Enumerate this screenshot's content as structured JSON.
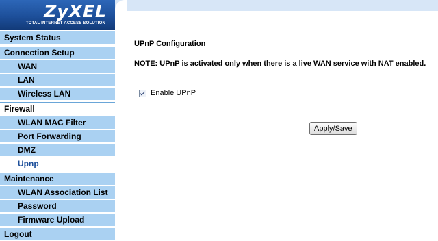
{
  "logo": {
    "brand": "ZyXEL",
    "tagline": "Total Internet Access Solution"
  },
  "sidebar": {
    "items": [
      {
        "label": "System Status"
      },
      {
        "label": "Connection Setup"
      },
      {
        "label": "WAN"
      },
      {
        "label": "LAN"
      },
      {
        "label": "Wireless LAN"
      },
      {
        "label": "Firewall"
      },
      {
        "label": "WLAN MAC Filter"
      },
      {
        "label": "Port Forwarding"
      },
      {
        "label": "DMZ"
      },
      {
        "label": "Upnp"
      },
      {
        "label": "Maintenance"
      },
      {
        "label": "WLAN Association List"
      },
      {
        "label": "Password"
      },
      {
        "label": "Firmware Upload"
      },
      {
        "label": "Logout"
      }
    ]
  },
  "main": {
    "title": "UPnP Configuration",
    "note": "NOTE: UPnP is activated only when there is a live WAN service with NAT enabled.",
    "enable_label": "Enable UPnP",
    "apply_label": "Apply/Save"
  }
}
